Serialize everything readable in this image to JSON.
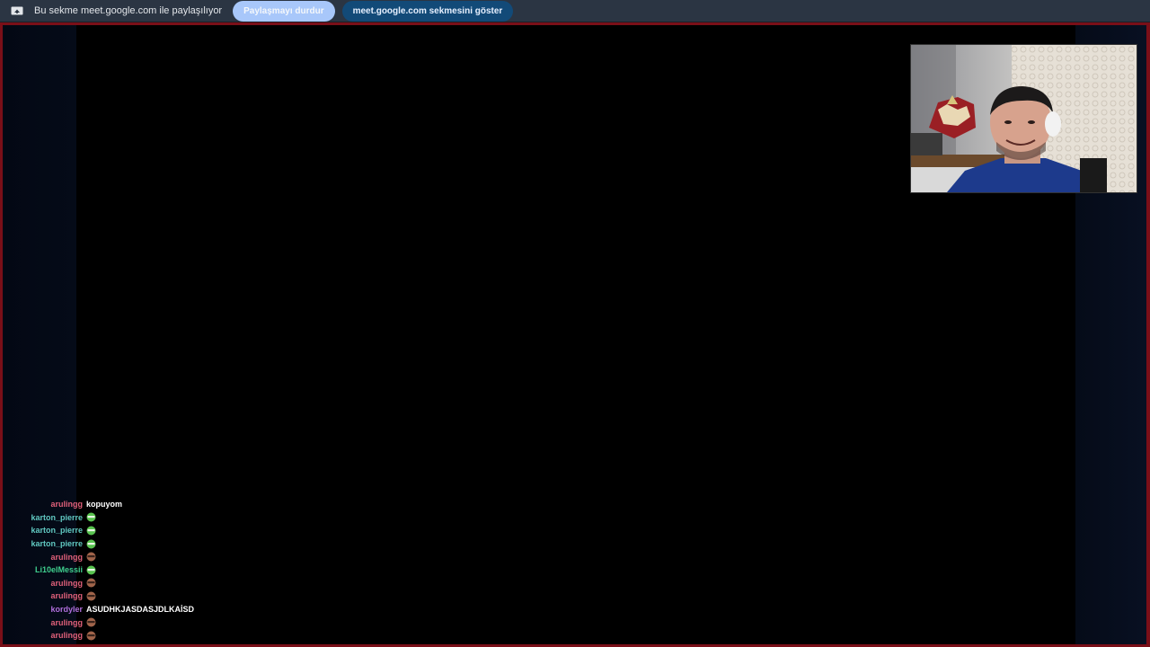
{
  "share_bar": {
    "text": "Bu sekme meet.google.com ile paylaşılıyor",
    "stop_label": "Paylaşmayı durdur",
    "show_label": "meet.google.com sekmesini göster",
    "icon": "screen-share-icon"
  },
  "colors": {
    "share_bar_bg": "#2b3543",
    "stop_button": "#a8c7fa",
    "show_button": "#124a78",
    "frame_border": "#7a0f18",
    "user_arulingg": "#e0607a",
    "user_karton": "#60c7c0",
    "user_li10": "#3fcf8e",
    "user_kordyler": "#b06fdc"
  },
  "chat": {
    "messages": [
      {
        "user": "arulingg",
        "color": "#e0607a",
        "text": "kopuyom",
        "emote": ""
      },
      {
        "user": "karton_pierre",
        "color": "#60c7c0",
        "text": "",
        "emote": "green-face-emote"
      },
      {
        "user": "karton_pierre",
        "color": "#60c7c0",
        "text": "",
        "emote": "green-face-emote"
      },
      {
        "user": "karton_pierre",
        "color": "#60c7c0",
        "text": "",
        "emote": "green-face-emote"
      },
      {
        "user": "arulingg",
        "color": "#e0607a",
        "text": "",
        "emote": "brown-face-emote"
      },
      {
        "user": "Li10elMessii",
        "color": "#3fcf8e",
        "text": "",
        "emote": "green-face-emote"
      },
      {
        "user": "arulingg",
        "color": "#e0607a",
        "text": "",
        "emote": "brown-face-emote"
      },
      {
        "user": "arulingg",
        "color": "#e0607a",
        "text": "",
        "emote": "brown-face-emote"
      },
      {
        "user": "kordyler",
        "color": "#b06fdc",
        "text": "ASUDHKJASDASJDLKAİSD",
        "emote": ""
      },
      {
        "user": "arulingg",
        "color": "#e0607a",
        "text": "",
        "emote": "brown-face-emote"
      },
      {
        "user": "arulingg",
        "color": "#e0607a",
        "text": "",
        "emote": "brown-face-emote"
      }
    ]
  }
}
